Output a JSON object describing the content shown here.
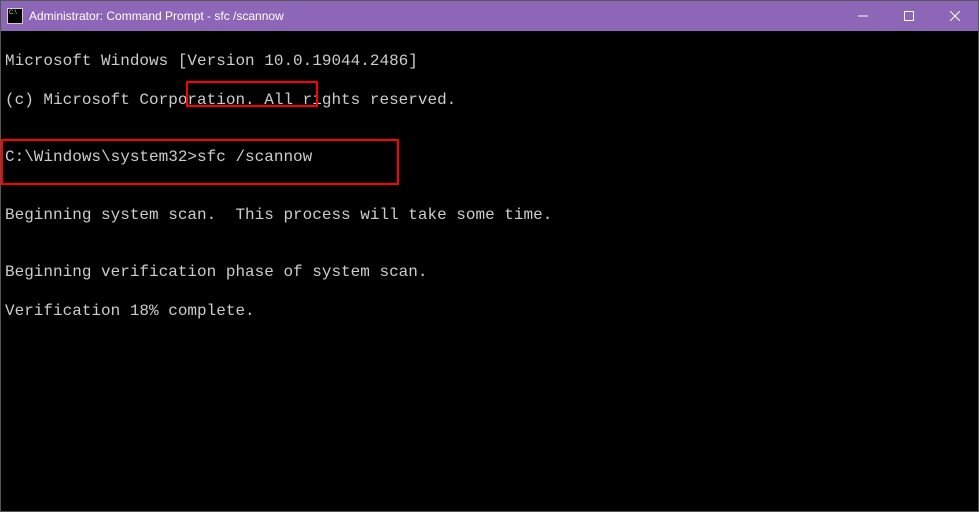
{
  "titlebar": {
    "title": "Administrator: Command Prompt - sfc  /scannow"
  },
  "terminal": {
    "line1": "Microsoft Windows [Version 10.0.19044.2486]",
    "line2": "(c) Microsoft Corporation. All rights reserved.",
    "blank1": "",
    "prompt": "C:\\Windows\\system32>",
    "command": "sfc /scannow",
    "blank2": "",
    "line3": "Beginning system scan.  This process will take some time.",
    "blank3": "",
    "line4": "Beginning verification phase of system scan.",
    "line5": "Verification 18% complete."
  }
}
